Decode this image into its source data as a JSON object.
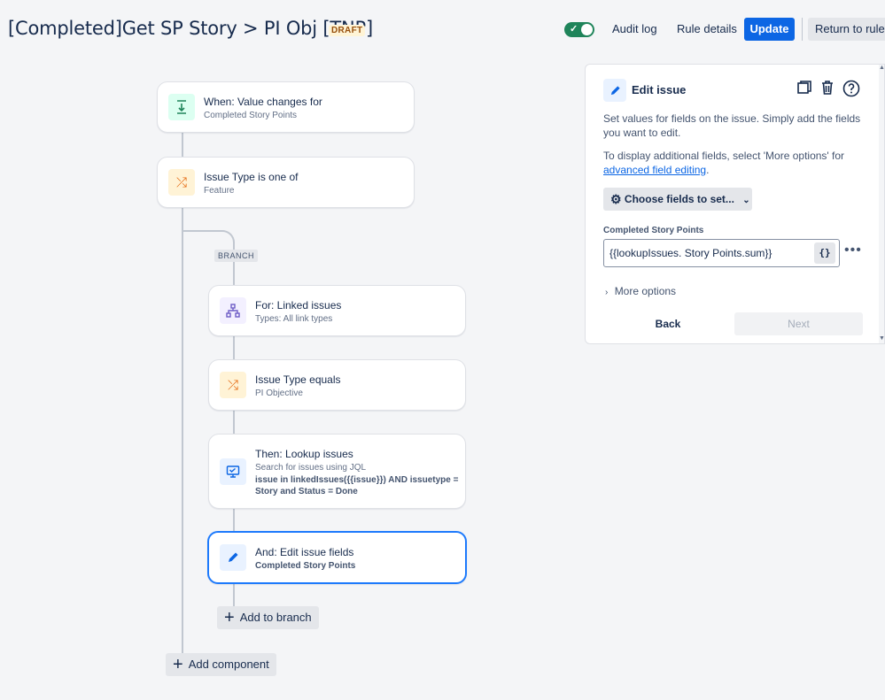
{
  "header": {
    "title": "[Completed]Get SP Story > PI Obj [TNP]",
    "badge": "DRAFT",
    "toggle_on": true,
    "audit_label": "Audit log",
    "details_label": "Rule details",
    "update_label": "Update",
    "return_label": "Return to rules"
  },
  "flow": {
    "trigger": {
      "title": "When: Value changes for",
      "subtitle": "Completed Story Points",
      "icon": "value-change-icon"
    },
    "condition": {
      "title": "Issue Type is one of",
      "subtitle": "Feature",
      "icon": "shuffle-icon"
    },
    "branch_label": "BRANCH",
    "branch_for": {
      "title": "For: Linked issues",
      "subtitle": "Types: All link types",
      "icon": "hierarchy-icon"
    },
    "branch_condition": {
      "title": "Issue Type equals",
      "subtitle": "PI Objective",
      "icon": "shuffle-icon"
    },
    "lookup": {
      "title": "Then: Lookup issues",
      "subtitle": "Search for issues using JQL",
      "jql": "issue in linkedIssues({{issue}}) AND issuetype = Story and Status = Done",
      "icon": "monitor-icon"
    },
    "edit": {
      "title": "And: Edit issue fields",
      "subtitle": "Completed Story Points",
      "icon": "pencil-icon"
    },
    "add_to_branch_label": "Add to branch",
    "add_component_label": "Add component"
  },
  "panel": {
    "title": "Edit issue",
    "desc1": "Set values for fields on the issue. Simply add the fields you want to edit.",
    "desc2_prefix": "To display additional fields, select 'More options' for ",
    "desc2_link": "advanced field editing",
    "desc2_suffix": ".",
    "choose_label": "Choose fields to set...",
    "field_label": "Completed Story Points",
    "field_value": "{{lookupIssues. Story Points.sum}}",
    "brace_label": "{}",
    "more_options_label": "More options",
    "back_label": "Back",
    "next_label": "Next"
  },
  "colors": {
    "accent": "#0c66e4",
    "toggle": "#1f845a",
    "selected_border": "#1d7afc"
  }
}
